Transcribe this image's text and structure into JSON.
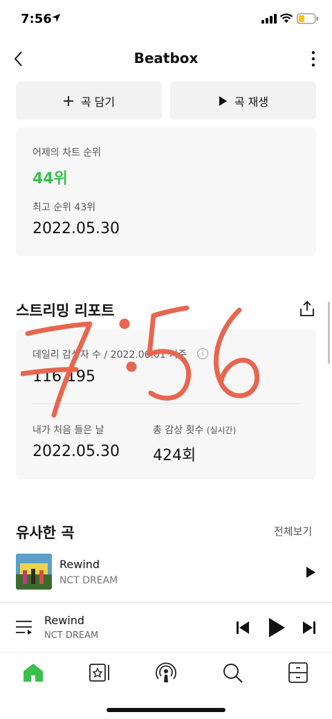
{
  "status_bar": {
    "time": "7:56"
  },
  "header": {
    "title": "Beatbox"
  },
  "actions": {
    "add_label": "곡 담기",
    "play_label": "곡 재생"
  },
  "chart_rank": {
    "yesterday_label": "어제의 차트 순위",
    "yesterday_value": "44위",
    "best_label": "최고 순위 43위",
    "best_date": "2022.05.30"
  },
  "streaming_report": {
    "title": "스트리밍 리포트",
    "daily_label": "데일리 감상자 수 / 2022.06.01 기준",
    "daily_value": "116,195",
    "first_listen_label": "내가 처음 들은 날",
    "first_listen_value": "2022.05.30",
    "total_plays_label": "총 감상 횟수",
    "total_plays_sub": "(실시간)",
    "total_plays_value": "424회"
  },
  "similar": {
    "title": "유사한 곡",
    "see_all": "전체보기",
    "songs": [
      {
        "title": "Rewind",
        "artist": "NCT DREAM"
      }
    ]
  },
  "player": {
    "title": "Rewind",
    "artist": "NCT DREAM"
  },
  "tabs": [
    "home-icon",
    "library-icon",
    "podcast-icon",
    "search-icon",
    "storage-icon"
  ],
  "overlay": {
    "handwriting": "7:56"
  },
  "colors": {
    "accent_green": "#3bbf4f",
    "overlay_red": "#e8664f"
  }
}
